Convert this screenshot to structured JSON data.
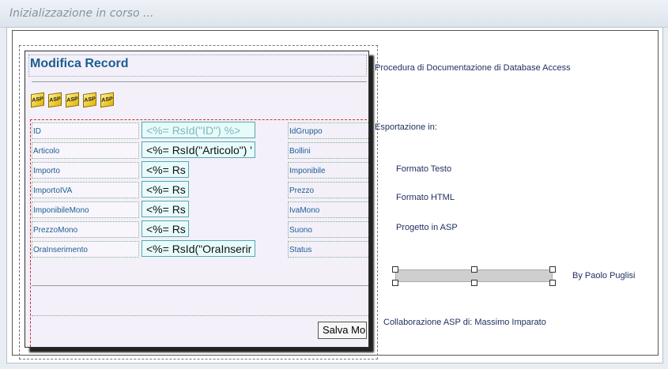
{
  "window": {
    "title": "Inizializzazione in corso ..."
  },
  "form": {
    "title": "Modifica Record",
    "asp_icons": [
      "ASP",
      "ASP",
      "ASP",
      "ASP",
      "ASP"
    ],
    "rows": [
      {
        "label": "ID",
        "value": "<%= RsId(\"ID\") %>",
        "label2": "IdGruppo"
      },
      {
        "label": "Articolo",
        "value": "<%= RsId(\"Articolo\") '",
        "label2": "Bollini"
      },
      {
        "label": "Importo",
        "value": "<%= Rs",
        "label2": "Imponibile"
      },
      {
        "label": "ImportoIVA",
        "value": "<%= Rs",
        "label2": "Prezzo"
      },
      {
        "label": "ImponibileMono",
        "value": "<%= Rs",
        "label2": "IvaMono"
      },
      {
        "label": "PrezzoMono",
        "value": "<%= Rs",
        "label2": "Suono"
      },
      {
        "label": "OraInserimento",
        "value": "<%= RsId(\"OraInserir",
        "label2": "Status"
      }
    ],
    "save_button": "Salva Mo"
  },
  "info": {
    "procedure": "Procedura di Documentazione di Database Access",
    "export_label": "Esportazione in:",
    "option_text": "Formato Testo",
    "option_html": "Formato HTML",
    "option_asp": "Progetto in ASP",
    "author": "By Paolo Puglisi",
    "collab": "Collaborazione ASP di:  Massimo Imparato"
  },
  "progress": {
    "value": 1.0
  }
}
